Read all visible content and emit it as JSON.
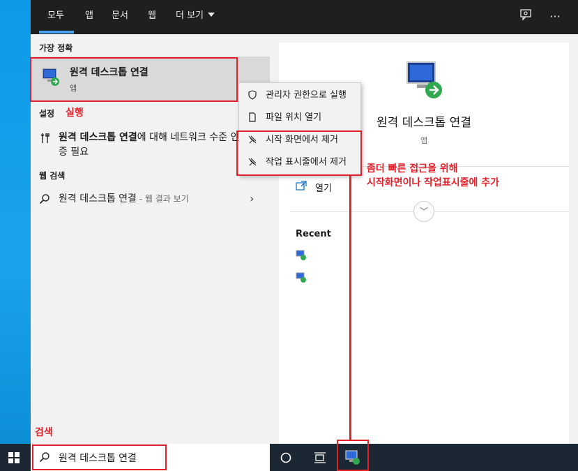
{
  "tabs": [
    "모두",
    "앱",
    "문서",
    "웹",
    "더 보기"
  ],
  "left": {
    "best_match_title": "가장 정확",
    "best_match": {
      "title": "원격 데스크톱 연결",
      "subtitle": "앱"
    },
    "settings_title": "설정",
    "setting_item": {
      "bold": "원격 데스크톱 연결",
      "rest": "에 대해 네트워크 수준 인증 필요"
    },
    "web_title": "웹 검색",
    "web_item": {
      "query": "원격 데스크톱 연결",
      "suffix": " - 웹 결과 보기"
    }
  },
  "context_menu": {
    "items": [
      {
        "label": "관리자 권한으로 실행",
        "icon": "shield-icon"
      },
      {
        "label": "파일 위치 열기",
        "icon": "file-icon"
      },
      {
        "label": "시작 화면에서 제거",
        "icon": "unpin-icon"
      },
      {
        "label": "작업 표시줄에서 제거",
        "icon": "unpin-icon"
      }
    ]
  },
  "right": {
    "app_title": "원격 데스크톱 연결",
    "app_type": "앱",
    "open_label": "열기",
    "recent_title": "Recent"
  },
  "annotations": {
    "run": "실행",
    "quick_access_line1": "좀더 빠른 접근을 위해",
    "quick_access_line2": "시작화면이나 작업표시줄에 추가",
    "search": "검색"
  },
  "search": {
    "value": "원격 데스크톱 연결"
  },
  "colors": {
    "accent": "#4aa3f0",
    "annotation": "#e0202a",
    "taskbar": "#1b2733"
  }
}
